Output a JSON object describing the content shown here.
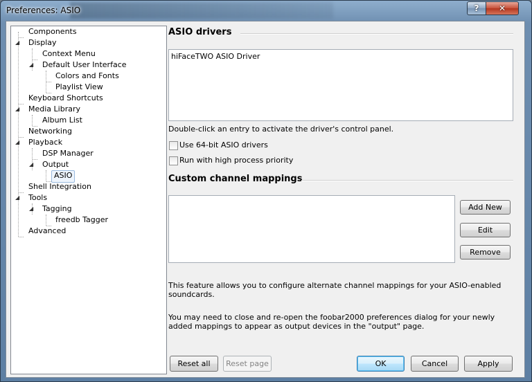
{
  "window": {
    "title": "Preferences: ASIO",
    "help_label": "?",
    "close_label": "✕"
  },
  "tree": {
    "items": [
      {
        "label": "Components"
      },
      {
        "label": "Display",
        "expander": "◢"
      },
      {
        "label": "Context Menu"
      },
      {
        "label": "Default User Interface",
        "expander": "◢"
      },
      {
        "label": "Colors and Fonts"
      },
      {
        "label": "Playlist View"
      },
      {
        "label": "Keyboard Shortcuts"
      },
      {
        "label": "Media Library",
        "expander": "◢"
      },
      {
        "label": "Album List"
      },
      {
        "label": "Networking"
      },
      {
        "label": "Playback",
        "expander": "◢"
      },
      {
        "label": "DSP Manager"
      },
      {
        "label": "Output",
        "expander": "◢"
      },
      {
        "label": "ASIO"
      },
      {
        "label": "Shell Integration"
      },
      {
        "label": "Tools",
        "expander": "◢"
      },
      {
        "label": "Tagging",
        "expander": "◢"
      },
      {
        "label": "freedb Tagger"
      },
      {
        "label": "Advanced"
      }
    ],
    "selected": "ASIO"
  },
  "asio": {
    "section_title": "ASIO drivers",
    "drivers": [
      "hiFaceTWO ASIO Driver"
    ],
    "hint": "Double-click an entry to activate the driver's control panel.",
    "use64_label": "Use 64-bit ASIO drivers",
    "use64_checked": false,
    "highprio_label": "Run with high process priority",
    "highprio_checked": false
  },
  "mappings": {
    "section_title": "Custom channel mappings",
    "add_label": "Add New",
    "edit_label": "Edit",
    "remove_label": "Remove",
    "info1_line1": "This feature allows you to configure alternate channel mappings for your ASIO-enabled",
    "info1_line2": "soundcards.",
    "info2_line1": "You may need to close and re-open the foobar2000 preferences dialog for your newly",
    "info2_line2": "added mappings to appear as output devices in the \"output\" page."
  },
  "footer": {
    "reset_all": "Reset all",
    "reset_page": "Reset page",
    "ok": "OK",
    "cancel": "Cancel",
    "apply": "Apply"
  }
}
